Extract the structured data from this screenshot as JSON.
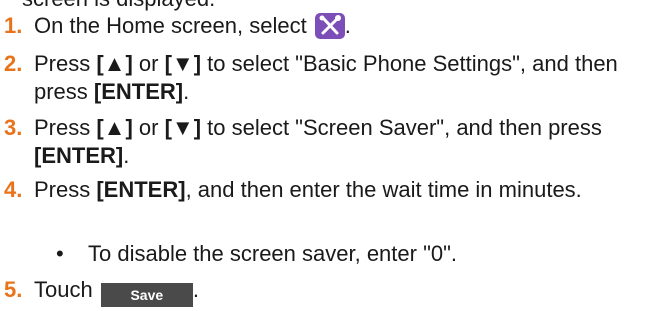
{
  "intro": "screen is displayed.",
  "steps": [
    {
      "num": "1.",
      "before": "On the Home screen, select ",
      "after": "."
    },
    {
      "num": "2.",
      "p1": "Press ",
      "k1": "[▲]",
      "p2": " or ",
      "k2": "[▼]",
      "p3": " to select \"Basic Phone Settings\", and then press ",
      "k3": "[ENTER]",
      "p4": "."
    },
    {
      "num": "3.",
      "p1": "Press ",
      "k1": "[▲]",
      "p2": " or ",
      "k2": "[▼]",
      "p3": " to select \"Screen Saver\", and then press ",
      "k3": "[ENTER]",
      "p4": "."
    },
    {
      "num": "4.",
      "p1": "Press ",
      "k1": "[ENTER]",
      "p2": ", and then enter the wait time in minutes."
    },
    {
      "num": "5.",
      "before": "Touch ",
      "button": "Save",
      "after": "."
    }
  ],
  "bullet": {
    "mark": "•",
    "text": "To disable the screen saver, enter \"0\"."
  },
  "icons": {
    "home_settings_icon": "settings-tools-icon"
  },
  "colors": {
    "step_number": "#e8731a",
    "icon_bg": "#7c4fb8",
    "save_button_bg": "#4a4a4a"
  }
}
